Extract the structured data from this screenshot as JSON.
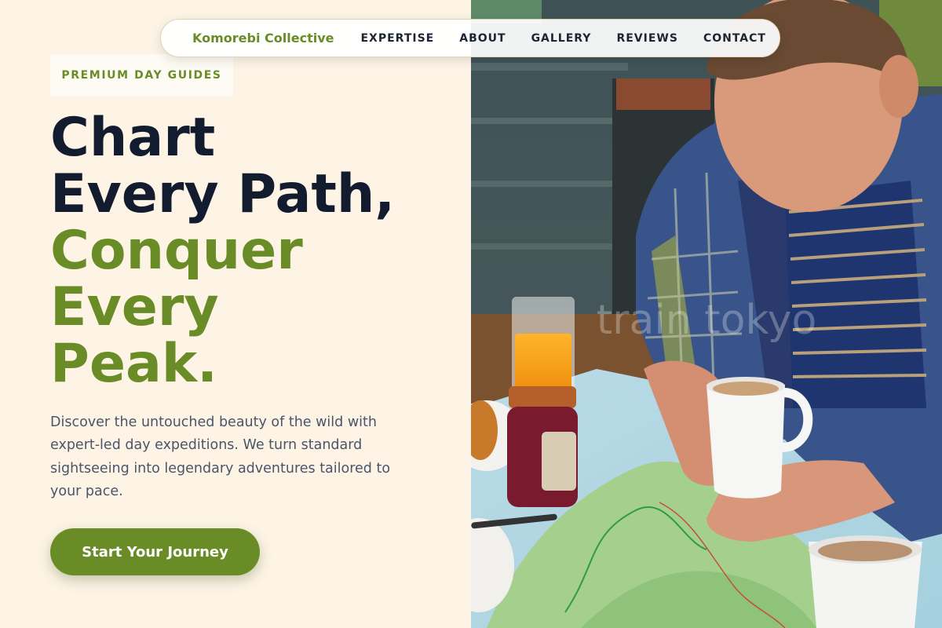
{
  "nav": {
    "brand": "Komorebi Collective",
    "items": [
      "EXPERTISE",
      "ABOUT",
      "GALLERY",
      "REVIEWS",
      "CONTACT"
    ]
  },
  "hero": {
    "badge": "PREMIUM DAY GUIDES",
    "headline_line1": "Chart",
    "headline_line2": "Every Path,",
    "headline_line3": "Conquer",
    "headline_line4": "Every",
    "headline_line5": "Peak.",
    "description": "Discover the untouched beauty of the wild with expert-led day expeditions. We turn standard sightseeing into legendary adventures tailored to your pace.",
    "cta": "Start Your Journey"
  },
  "photo": {
    "watermark": "train tokyo"
  },
  "colors": {
    "accent_green": "#6a8c26",
    "headline_dark": "#131b2e",
    "background_cream": "#fdf4e6"
  }
}
